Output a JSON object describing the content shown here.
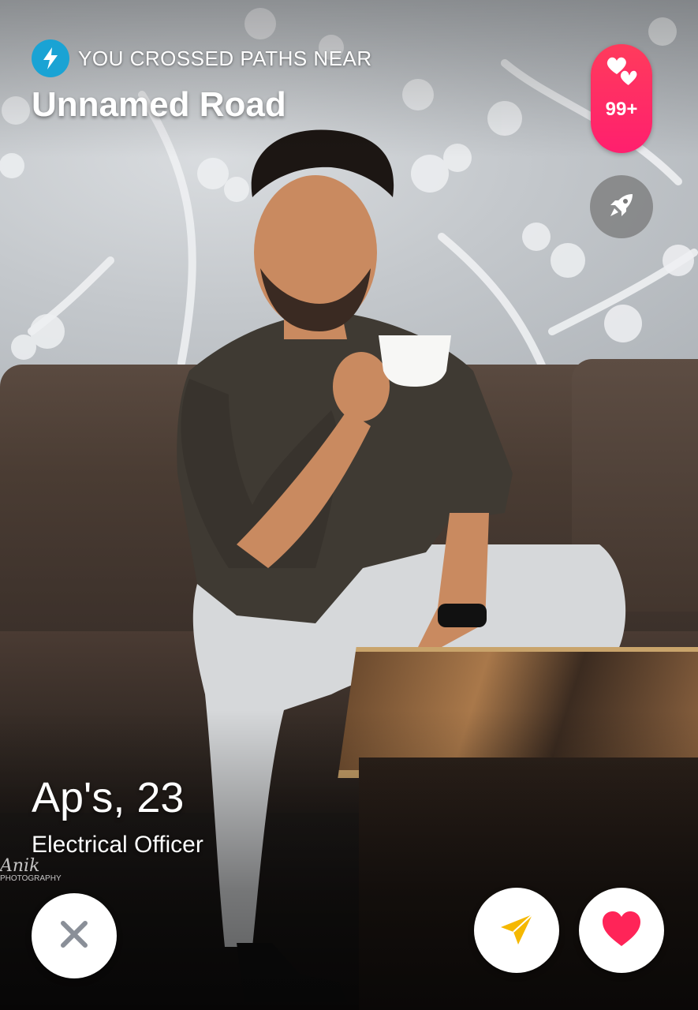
{
  "header": {
    "crossed_paths_label": "YOU CROSSED PATHS NEAR",
    "location": "Unnamed Road"
  },
  "likes": {
    "count_label": "99+"
  },
  "profile": {
    "name_age": "Ap's, 23",
    "job": "Electrical Officer"
  },
  "photo": {
    "watermark_script": "Anik",
    "watermark_small": "PHOTOGRAPHY"
  },
  "icons": {
    "passport": "lightning-bolt-icon",
    "likes": "double-heart-icon",
    "boost": "rocket-icon",
    "nope": "x-icon",
    "super_like": "send-arrow-icon",
    "like": "heart-icon"
  },
  "colors": {
    "passport_badge": "#1aa3d4",
    "likes_pill": "#ff2d64",
    "nope_icon": "#8a8f98",
    "super_like_icon": "#f5b800",
    "like_icon": "#ff2458"
  }
}
